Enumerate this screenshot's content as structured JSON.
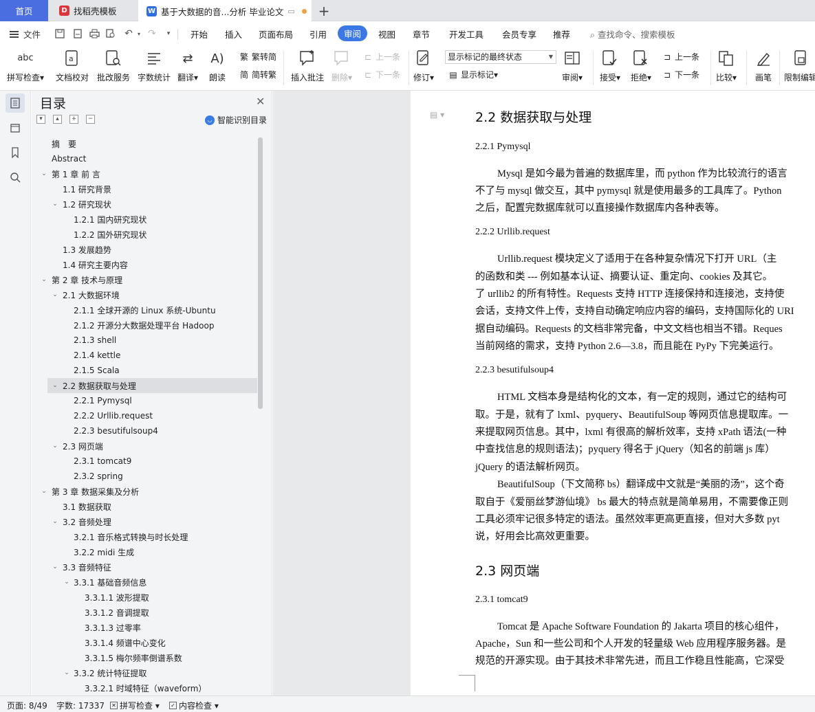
{
  "tabs": {
    "home": "首页",
    "template": "找稻壳模板",
    "document": "基于大数据的音...分析 毕业论文",
    "add": "+"
  },
  "menu": {
    "file": "文件",
    "items": [
      "开始",
      "插入",
      "页面布局",
      "引用",
      "审阅",
      "视图",
      "章节",
      "开发工具",
      "会员专享",
      "推荐"
    ],
    "active": "审阅",
    "search": "查找命令、搜索模板"
  },
  "ribbon": {
    "spellcheck_icon_text": "abc",
    "spellcheck": "拼写检查",
    "doc_proofread": "文档校对",
    "batch_service": "批改服务",
    "word_count": "字数统计",
    "translate": "翻译",
    "read_aloud": "朗读",
    "trad_to_simp": "繁转简",
    "simp_to_trad": "简转繁",
    "insert_comment": "插入批注",
    "delete": "删除",
    "prev_comment": "上一条",
    "next_comment": "下一条",
    "revise": "修订",
    "display_mode": "显示标记的最终状态",
    "show_markup": "显示标记",
    "review": "审阅",
    "accept": "接受",
    "reject": "拒绝",
    "prev_change": "上一条",
    "next_change": "下一条",
    "compare": "比较",
    "pen": "画笔",
    "restrict_edit": "限制编辑"
  },
  "toc": {
    "title": "目录",
    "smart_recognize": "智能识别目录",
    "items": [
      {
        "text": "摘　要",
        "level": 1,
        "arrow": ""
      },
      {
        "text": "Abstract",
        "level": 1,
        "arrow": ""
      },
      {
        "text": "第 1 章  前  言",
        "level": 1,
        "arrow": "v"
      },
      {
        "text": "1.1  研究背景",
        "level": 2,
        "arrow": ""
      },
      {
        "text": "1.2  研究现状",
        "level": 2,
        "arrow": "v"
      },
      {
        "text": "1.2.1  国内研究现状",
        "level": 3,
        "arrow": ""
      },
      {
        "text": "1.2.2  国外研究现状",
        "level": 3,
        "arrow": ""
      },
      {
        "text": "1.3  发展趋势",
        "level": 2,
        "arrow": ""
      },
      {
        "text": "1.4  研究主要内容",
        "level": 2,
        "arrow": ""
      },
      {
        "text": "第 2 章  技术与原理",
        "level": 1,
        "arrow": "v"
      },
      {
        "text": "2.1  大数据环境",
        "level": 2,
        "arrow": "v"
      },
      {
        "text": "2.1.1  全球开源的 Linux 系统-Ubuntu",
        "level": 3,
        "arrow": ""
      },
      {
        "text": "2.1.2  开源分大数据处理平台 Hadoop",
        "level": 3,
        "arrow": ""
      },
      {
        "text": "2.1.3 shell",
        "level": 3,
        "arrow": ""
      },
      {
        "text": "2.1.4 kettle",
        "level": 3,
        "arrow": ""
      },
      {
        "text": "2.1.5 Scala",
        "level": 3,
        "arrow": ""
      },
      {
        "text": "2.2  数据获取与处理",
        "level": 2,
        "arrow": "v",
        "selected": true
      },
      {
        "text": "2.2.1 Pymysql",
        "level": 3,
        "arrow": ""
      },
      {
        "text": "2.2.2 Urllib.request",
        "level": 3,
        "arrow": ""
      },
      {
        "text": "2.2.3 besutifulsoup4",
        "level": 3,
        "arrow": ""
      },
      {
        "text": "2.3 网页端",
        "level": 2,
        "arrow": "v"
      },
      {
        "text": "2.3.1 tomcat9",
        "level": 3,
        "arrow": ""
      },
      {
        "text": "2.3.2 spring",
        "level": 3,
        "arrow": ""
      },
      {
        "text": "第 3 章  数据采集及分析",
        "level": 1,
        "arrow": "v"
      },
      {
        "text": "3.1  数据获取",
        "level": 2,
        "arrow": ""
      },
      {
        "text": "3.2  音频处理",
        "level": 2,
        "arrow": "v"
      },
      {
        "text": "3.2.1  音乐格式转换与时长处理",
        "level": 3,
        "arrow": ""
      },
      {
        "text": "3.2.2 midi 生成",
        "level": 3,
        "arrow": ""
      },
      {
        "text": "3.3  音频特征",
        "level": 2,
        "arrow": "v"
      },
      {
        "text": "3.3.1  基础音频信息",
        "level": 3,
        "arrow": "v"
      },
      {
        "text": "3.3.1.1  波形提取",
        "level": 4,
        "arrow": ""
      },
      {
        "text": "3.3.1.2  音调提取",
        "level": 4,
        "arrow": ""
      },
      {
        "text": "3.3.1.3  过零率",
        "level": 4,
        "arrow": ""
      },
      {
        "text": "3.3.1.4  频谱中心变化",
        "level": 4,
        "arrow": ""
      },
      {
        "text": "3.3.1.5  梅尔频率倒谱系数",
        "level": 4,
        "arrow": ""
      },
      {
        "text": "3.3.2  统计特征提取",
        "level": 3,
        "arrow": "v"
      },
      {
        "text": "3.3.2.1  时域特征（waveform）",
        "level": 4,
        "arrow": ""
      }
    ]
  },
  "document": {
    "h_2_2": "2.2  数据获取与处理",
    "h_2_2_1": "2.2.1 Pymysql",
    "p1": [
      "Mysql 是如今最为普遍的数据库里，而 python 作为比较流行的语言",
      "不了与 mysql 做交互，其中 pymysql 就是使用最多的工具库了。Python",
      "之后，配置完数据库就可以直接操作数据库内各种表等。"
    ],
    "h_2_2_2": "2.2.2 Urllib.request",
    "p2": [
      "Urllib.request  模块定义了适用于在各种复杂情况下打开  URL（主",
      "的函数和类  ---  例如基本认证、摘要认证、重定向、cookies  及其它。",
      "了 urllib2 的所有特性。Requests 支持 HTTP 连接保持和连接池，支持使",
      "会话，支持文件上传，支持自动确定响应内容的编码，支持国际化的  URI",
      "据自动编码。Requests 的文档非常完备，中文文档也相当不错。Reques",
      "当前网络的需求，支持 Python 2.6—3.8，而且能在 PyPy 下完美运行。"
    ],
    "h_2_2_3": "2.2.3 besutifulsoup4",
    "p3": [
      "HTML  文档本身是结构化的文本，有一定的规则，通过它的结构可",
      "取。于是，就有了 lxml、pyquery、BeautifulSoup 等网页信息提取库。一",
      "来提取网页信息。其中，lxml  有很高的解析效率，支持  xPath  语法(一种",
      "中查找信息的规则语法)；pyquery  得名于  jQuery（知名的前端  js  库）",
      "jQuery  的语法解析网页。"
    ],
    "p4": [
      "BeautifulSoup（下文简称  bs）翻译成中文就是“美丽的汤”，这个奇",
      "取自于《爱丽丝梦游仙境》 bs  最大的特点就是简单易用，不需要像正则",
      "工具必须牢记很多特定的语法。虽然效率更高更直接，但对大多数  pyt",
      "说，好用会比高效更重要。"
    ],
    "h_2_3": "2.3 网页端",
    "h_2_3_1": "2.3.1 tomcat9",
    "p5": [
      "Tomcat 是 Apache Software Foundation 的 Jakarta 项目的核心组件，",
      "Apache，Sun 和一些公司和个人开发的轻量级 Web 应用程序服务器。是",
      "规范的开源实现。由于其技术非常先进，而且工作稳且性能高，它深受"
    ]
  },
  "status": {
    "page": "页面: 8/49",
    "words": "字数: 17337",
    "spellcheck": "拼写检查",
    "content_check": "内容检查"
  },
  "colors": {
    "accent": "#3a78e6",
    "home_tab": "#4a6ee0",
    "unsaved_dot": "#f0a23a"
  }
}
